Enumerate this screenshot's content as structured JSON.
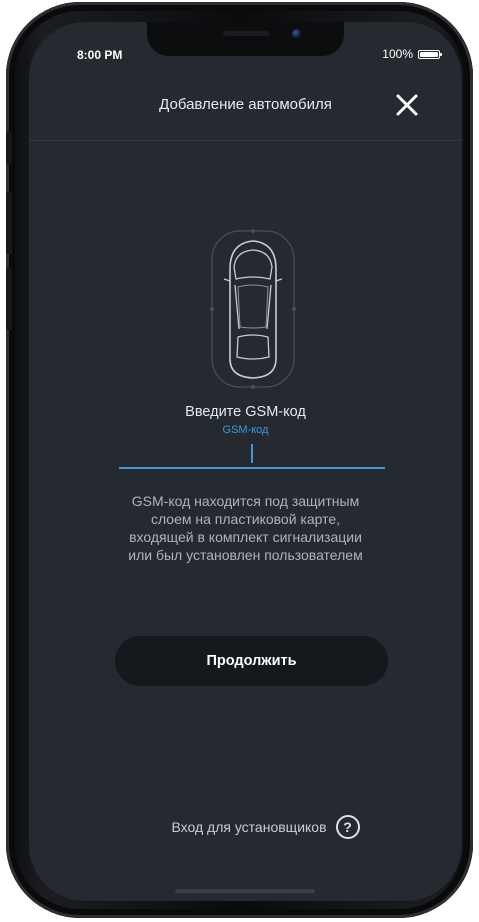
{
  "status_bar": {
    "time": "8:00 PM",
    "battery": "100%"
  },
  "header": {
    "title": "Добавление автомобиля",
    "close_icon": "close-icon"
  },
  "car_illustration": {
    "icon": "car-top-view-icon"
  },
  "gsm_form": {
    "prompt": "Введите GSM-код",
    "field_label": "GSM-код",
    "value": ""
  },
  "hint": {
    "lines": [
      "GSM-код находится под защитным",
      "слоем на пластиковой карте,",
      "входящей в комплект сигнализации",
      "или был установлен пользователем"
    ]
  },
  "continue_button": {
    "label": "Продолжить"
  },
  "installer_login": {
    "label": "Вход для установщиков",
    "help_icon": "?"
  },
  "colors": {
    "background": "#252a31",
    "accent": "#3d97d9",
    "button": "#15181c",
    "text": "#e6e8ec"
  }
}
